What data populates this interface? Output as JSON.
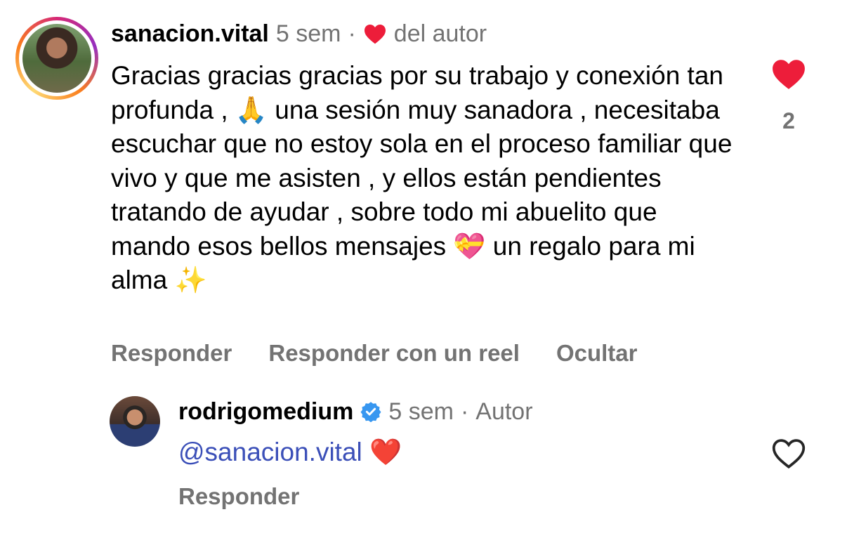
{
  "comments": [
    {
      "username": "sanacion.vital",
      "time": "5 sem",
      "separator": "·",
      "author_like_label": "del autor",
      "text": "Gracias gracias gracias por su trabajo y conexión tan profunda , 🙏 una sesión muy sanadora , necesitaba escuchar que no estoy sola en el proceso familiar que vivo y que me asisten , y ellos están pendientes tratando de ayudar , sobre todo mi abuelito que mando esos bellos mensajes 💝 un regalo para mi alma ✨",
      "actions": [
        "Responder",
        "Responder con un reel",
        "Ocultar"
      ],
      "like_count": "2",
      "liked": true,
      "like_color": "#ed1d3a"
    },
    {
      "username": "rodrigomedium",
      "verified": true,
      "time": "5 sem",
      "separator": "·",
      "role": "Autor",
      "mention": "@sanacion.vital",
      "emoji": "❤️",
      "actions": [
        "Responder"
      ],
      "liked": false
    }
  ],
  "colors": {
    "meta_gray": "#737373",
    "mention_blue": "#3b4fb8",
    "verified_blue": "#3897f0",
    "heart_red": "#ed1d3a"
  },
  "icons": {
    "heart": "heart-icon",
    "heart_outline": "heart-outline-icon",
    "verified": "verified-badge-icon"
  }
}
